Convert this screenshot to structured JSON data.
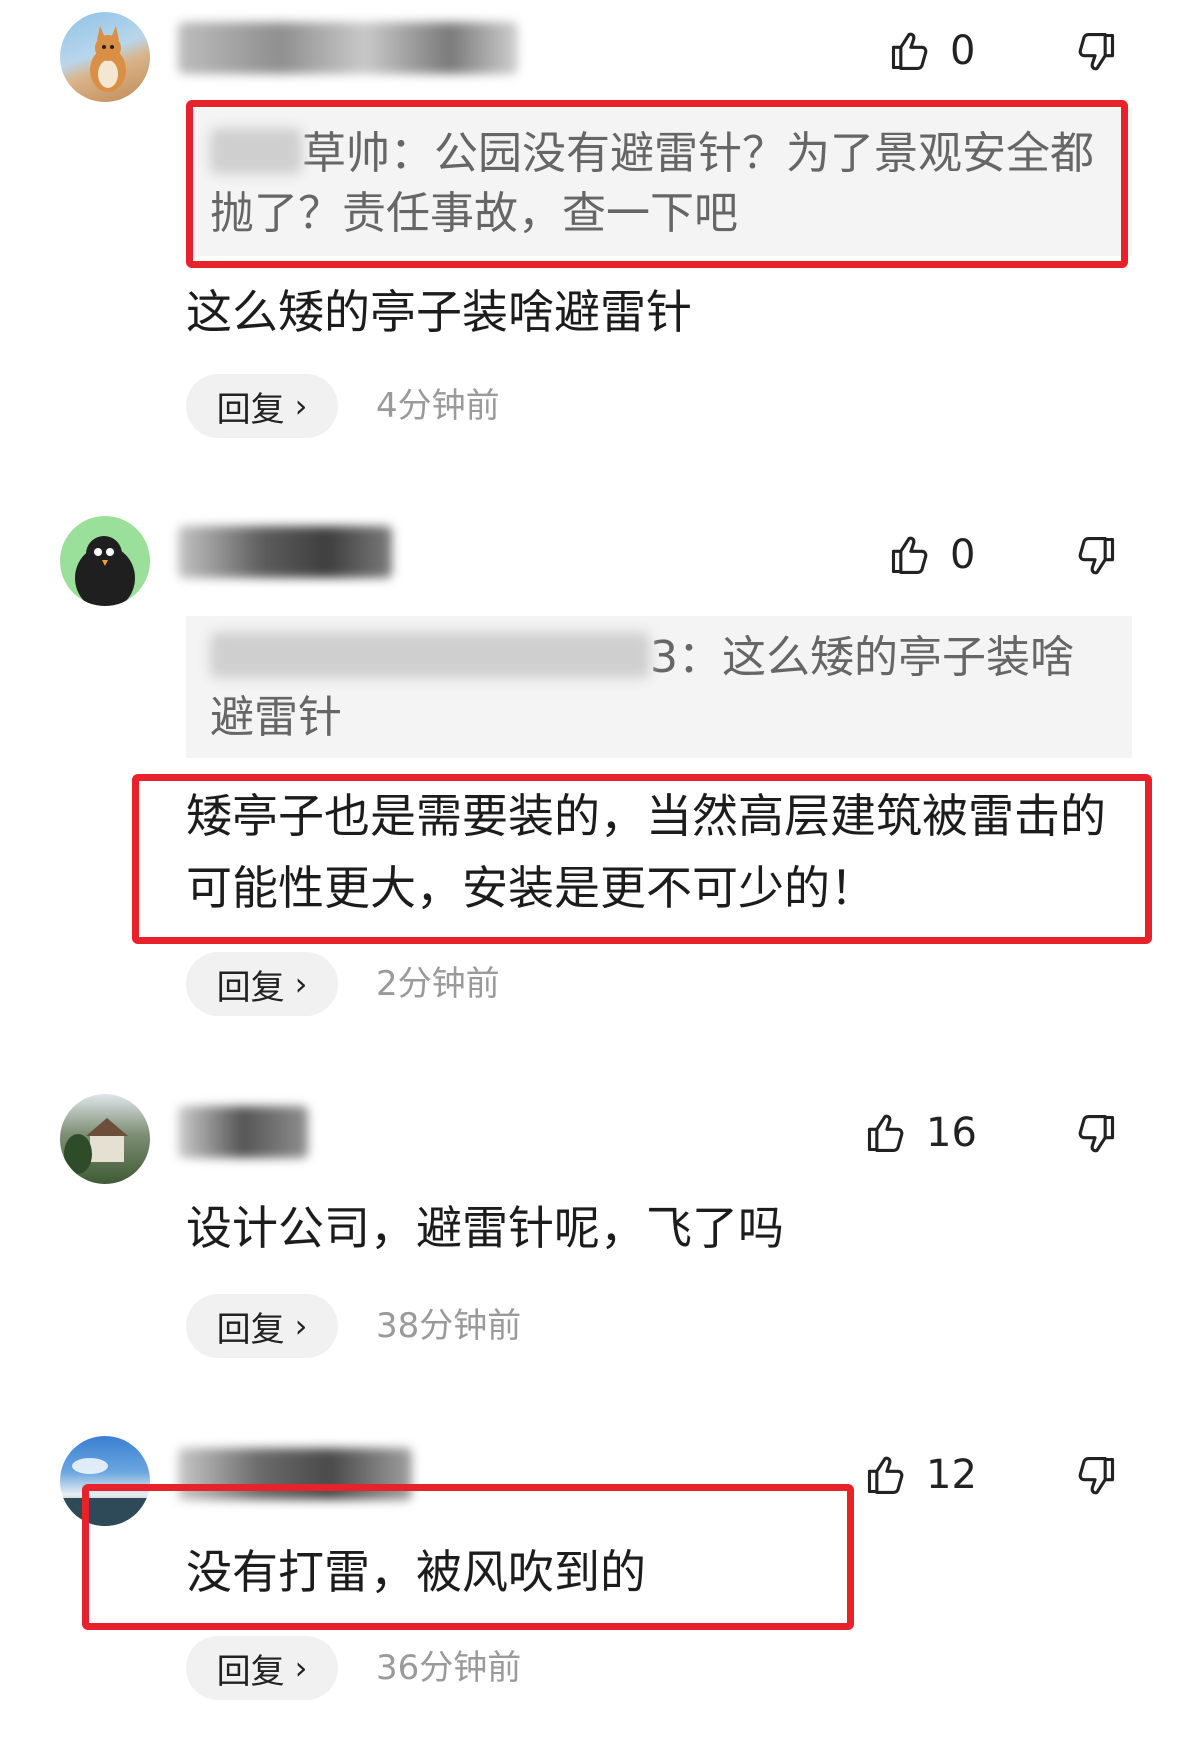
{
  "comments": [
    {
      "likes": "0",
      "quote_suffix": "草帅：公园没有避雷针？为了景观安全都抛了？责任事故，查一下吧",
      "text": "这么矮的亭子装啥避雷针",
      "reply_label": "回复",
      "time": "4分钟前"
    },
    {
      "likes": "0",
      "quote_suffix": "3：这么矮的亭子装啥避雷针",
      "text": "矮亭子也是需要装的，当然高层建筑被雷击的可能性更大，安装是更不可少的！",
      "reply_label": "回复",
      "time": "2分钟前"
    },
    {
      "likes": "16",
      "text": "设计公司，避雷针呢，飞了吗",
      "reply_label": "回复",
      "time": "38分钟前"
    },
    {
      "likes": "12",
      "text": "没有打雷，被风吹到的",
      "reply_label": "回复",
      "time": "36分钟前"
    }
  ],
  "colors": {
    "highlight": "#e8222b",
    "quote_bg": "#f4f4f4",
    "reply_bg": "#f1f1f1",
    "meta": "#9a9a9a"
  },
  "icons": {
    "like": "thumbs-up-icon",
    "dislike": "thumbs-down-icon",
    "reply": "chevron-right-icon"
  }
}
